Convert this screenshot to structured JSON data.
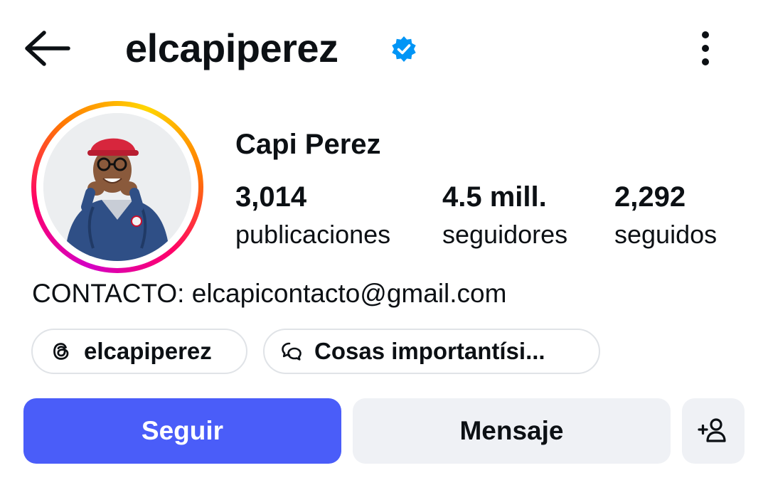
{
  "header": {
    "username": "elcapiperez",
    "verified": true,
    "icons": {
      "back": "arrow-left-icon",
      "verified": "verified-badge-icon",
      "more": "more-vertical-icon"
    }
  },
  "profile": {
    "full_name": "Capi Perez",
    "avatar": "profile-photo",
    "stats": {
      "posts": {
        "value": "3,014",
        "label": "publicaciones"
      },
      "followers": {
        "value": "4.5 mill.",
        "label": "seguidores"
      },
      "following": {
        "value": "2,292",
        "label": "seguidos"
      }
    },
    "bio": "CONTACTO: elcapicontacto@gmail.com"
  },
  "chips": [
    {
      "icon": "threads-icon",
      "label": "elcapiperez"
    },
    {
      "icon": "chat-bubbles-icon",
      "label": "Cosas importantísi..."
    }
  ],
  "actions": {
    "follow_label": "Seguir",
    "message_label": "Mensaje",
    "suggest_icon": "add-person-icon"
  },
  "colors": {
    "accent": "#4a5df9",
    "verified": "#0095f6",
    "secondary_button": "#eff1f5",
    "text": "#0c1014"
  }
}
